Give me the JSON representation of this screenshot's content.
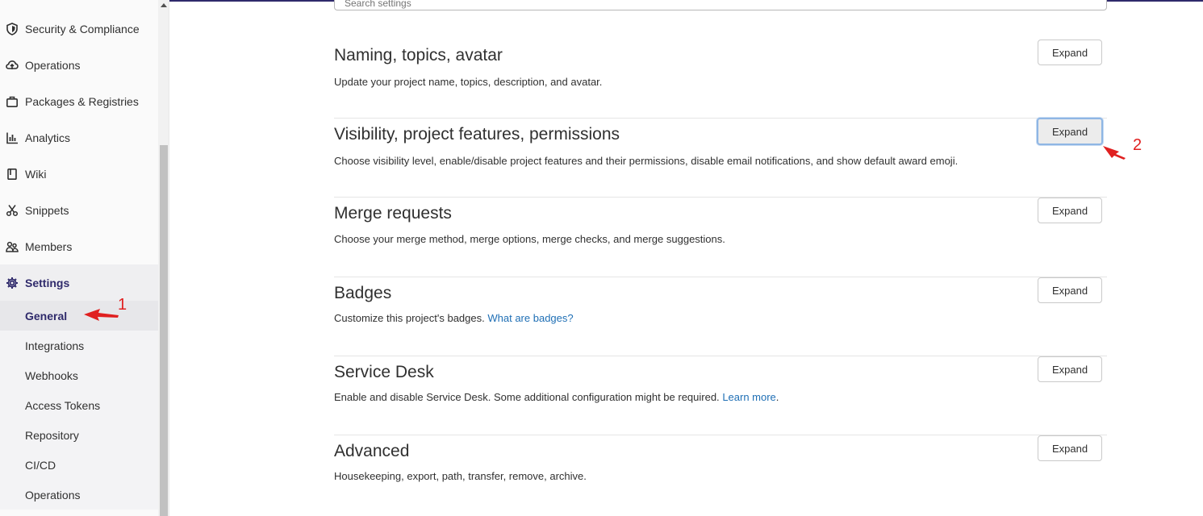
{
  "sidebar": {
    "items": [
      {
        "label": "Security & Compliance",
        "icon": "shield-icon"
      },
      {
        "label": "Operations",
        "icon": "cloud-icon"
      },
      {
        "label": "Packages & Registries",
        "icon": "package-icon"
      },
      {
        "label": "Analytics",
        "icon": "chart-icon"
      },
      {
        "label": "Wiki",
        "icon": "book-icon"
      },
      {
        "label": "Snippets",
        "icon": "scissors-icon"
      },
      {
        "label": "Members",
        "icon": "users-icon"
      },
      {
        "label": "Settings",
        "icon": "gear-icon"
      }
    ],
    "settings_subitems": [
      "General",
      "Integrations",
      "Webhooks",
      "Access Tokens",
      "Repository",
      "CI/CD",
      "Operations"
    ]
  },
  "search": {
    "placeholder": "Search settings"
  },
  "sections": [
    {
      "title": "Naming, topics, avatar",
      "description": "Update your project name, topics, description, and avatar.",
      "link": "",
      "suffix": "",
      "button": "Expand"
    },
    {
      "title": "Visibility, project features, permissions",
      "description": "Choose visibility level, enable/disable project features and their permissions, disable email notifications, and show default award emoji.",
      "link": "",
      "suffix": "",
      "button": "Expand"
    },
    {
      "title": "Merge requests",
      "description": "Choose your merge method, merge options, merge checks, and merge suggestions.",
      "link": "",
      "suffix": "",
      "button": "Expand"
    },
    {
      "title": "Badges",
      "description": "Customize this project's badges.",
      "link": "What are badges?",
      "suffix": "",
      "button": "Expand"
    },
    {
      "title": "Service Desk",
      "description": "Enable and disable Service Desk. Some additional configuration might be required.",
      "link": "Learn more",
      "suffix": ".",
      "button": "Expand"
    },
    {
      "title": "Advanced",
      "description": "Housekeeping, export, path, transfer, remove, archive.",
      "link": "",
      "suffix": "",
      "button": "Expand"
    }
  ],
  "annotations": {
    "first": "1",
    "second": "2"
  },
  "colors": {
    "accent": "#2f2a6b",
    "link": "#1f6fb5",
    "annotation": "#e02020"
  }
}
